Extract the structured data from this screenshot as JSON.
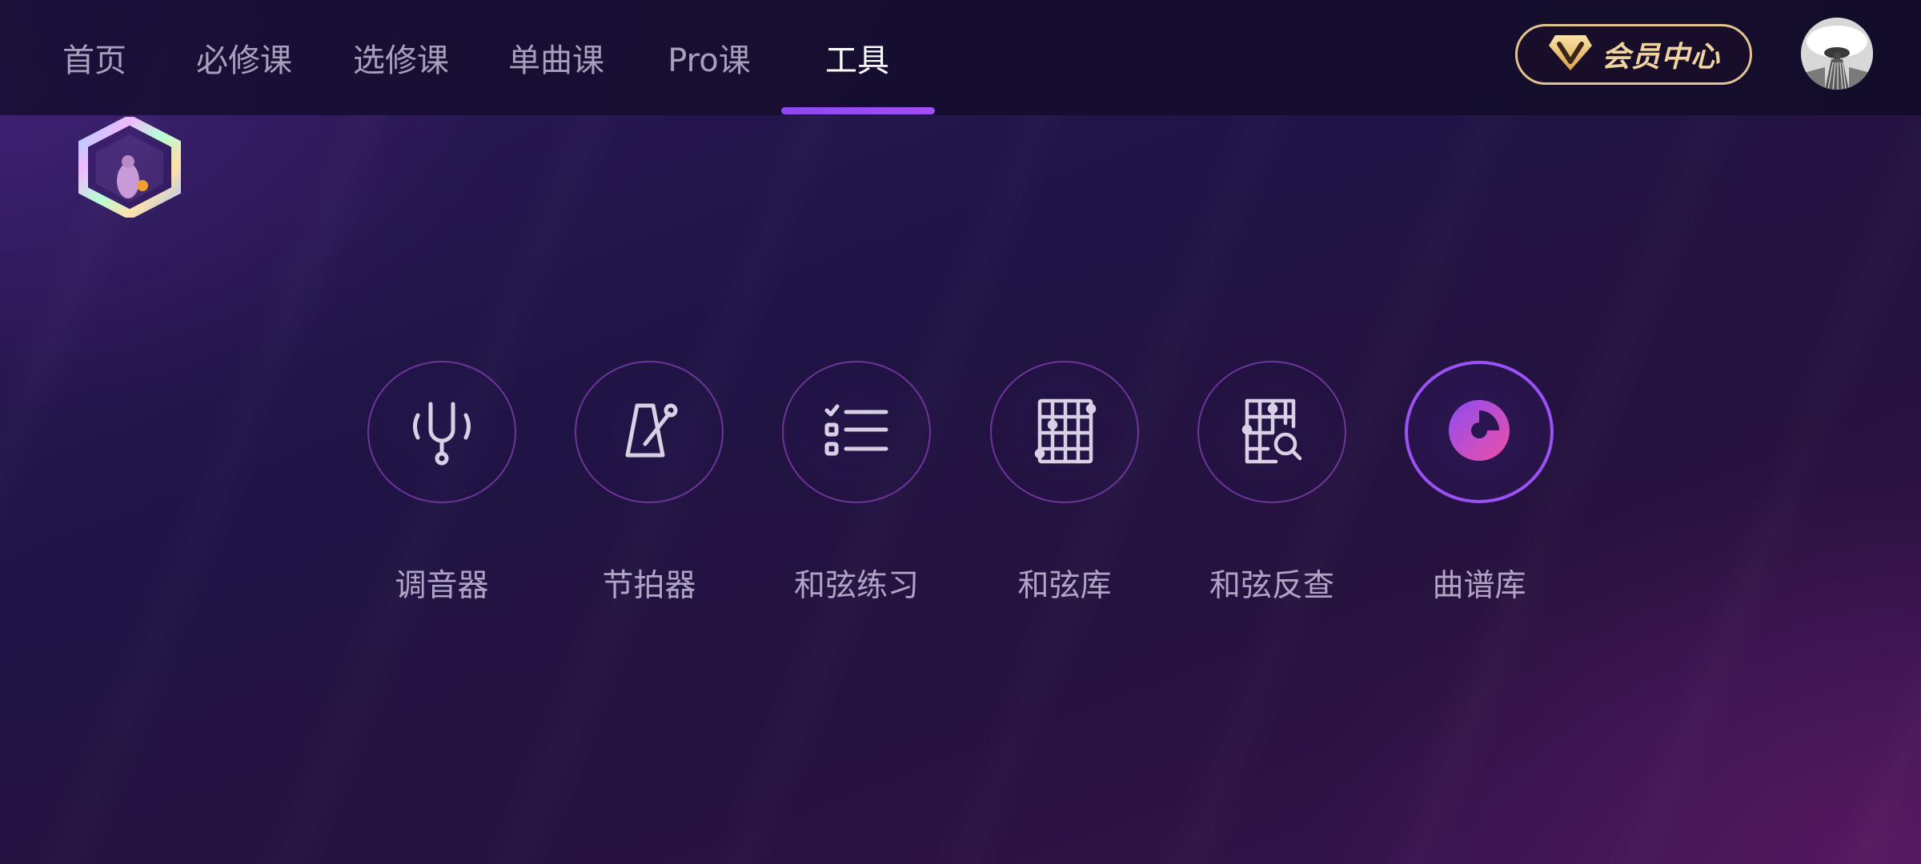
{
  "nav": {
    "items": [
      {
        "label": "首页"
      },
      {
        "label": "必修课"
      },
      {
        "label": "选修课"
      },
      {
        "label": "单曲课"
      },
      {
        "label": "Pro课"
      },
      {
        "label": "工具"
      }
    ],
    "active": "工具"
  },
  "vip": {
    "label": "会员中心",
    "icon": "vip-diamond-icon"
  },
  "profile": {
    "icon": "avatar"
  },
  "badge": {
    "icon": "hexagon-badge-icon"
  },
  "tools": [
    {
      "label": "调音器",
      "icon": "tuning-fork-icon"
    },
    {
      "label": "节拍器",
      "icon": "metronome-icon"
    },
    {
      "label": "和弦练习",
      "icon": "checklist-icon"
    },
    {
      "label": "和弦库",
      "icon": "chord-grid-icon"
    },
    {
      "label": "和弦反查",
      "icon": "chord-search-icon"
    },
    {
      "label": "曲谱库",
      "icon": "music-disc-icon"
    }
  ],
  "colors": {
    "accent": "#9a52f5",
    "vip_gold": "#e2c28d",
    "background": "#211548"
  }
}
